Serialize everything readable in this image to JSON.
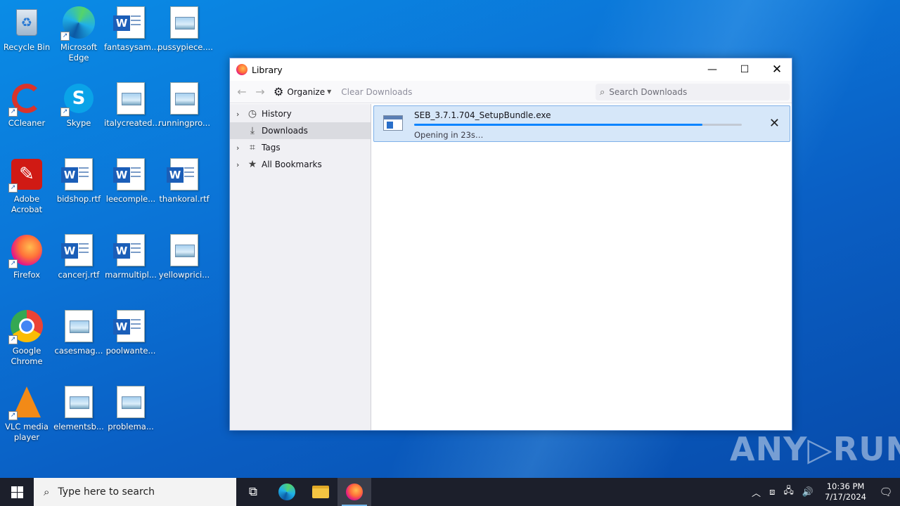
{
  "desktop": {
    "icons": [
      {
        "label": "Recycle Bin"
      },
      {
        "label": "Microsoft Edge"
      },
      {
        "label": "fantasysam..."
      },
      {
        "label": "pussypiece...."
      },
      {
        "label": "CCleaner"
      },
      {
        "label": "Skype"
      },
      {
        "label": "italycreated..."
      },
      {
        "label": "runningpro..."
      },
      {
        "label": "Adobe Acrobat"
      },
      {
        "label": "bidshop.rtf"
      },
      {
        "label": "leecomple..."
      },
      {
        "label": "thankoral.rtf"
      },
      {
        "label": "Firefox"
      },
      {
        "label": "cancerj.rtf"
      },
      {
        "label": "marmultipl..."
      },
      {
        "label": "yellowprici..."
      },
      {
        "label": "Google Chrome"
      },
      {
        "label": "casesmag..."
      },
      {
        "label": "poolwante..."
      },
      {
        "label": "VLC media player"
      },
      {
        "label": "elementsb..."
      },
      {
        "label": "problema..."
      }
    ]
  },
  "window": {
    "title": "Library",
    "toolbar": {
      "organize_label": "Organize",
      "clear_label": "Clear Downloads",
      "search_placeholder": "Search Downloads"
    },
    "sidebar": {
      "items": [
        {
          "label": "History"
        },
        {
          "label": "Downloads"
        },
        {
          "label": "Tags"
        },
        {
          "label": "All Bookmarks"
        }
      ]
    },
    "download": {
      "filename": "SEB_3.7.1.704_SetupBundle.exe",
      "status": "Opening in 23s…",
      "progress_fraction": 0.88
    }
  },
  "watermark": "ANY▷RUN",
  "taskbar": {
    "search_placeholder": "Type here to search",
    "time": "10:36 PM",
    "date": "7/17/2024"
  }
}
